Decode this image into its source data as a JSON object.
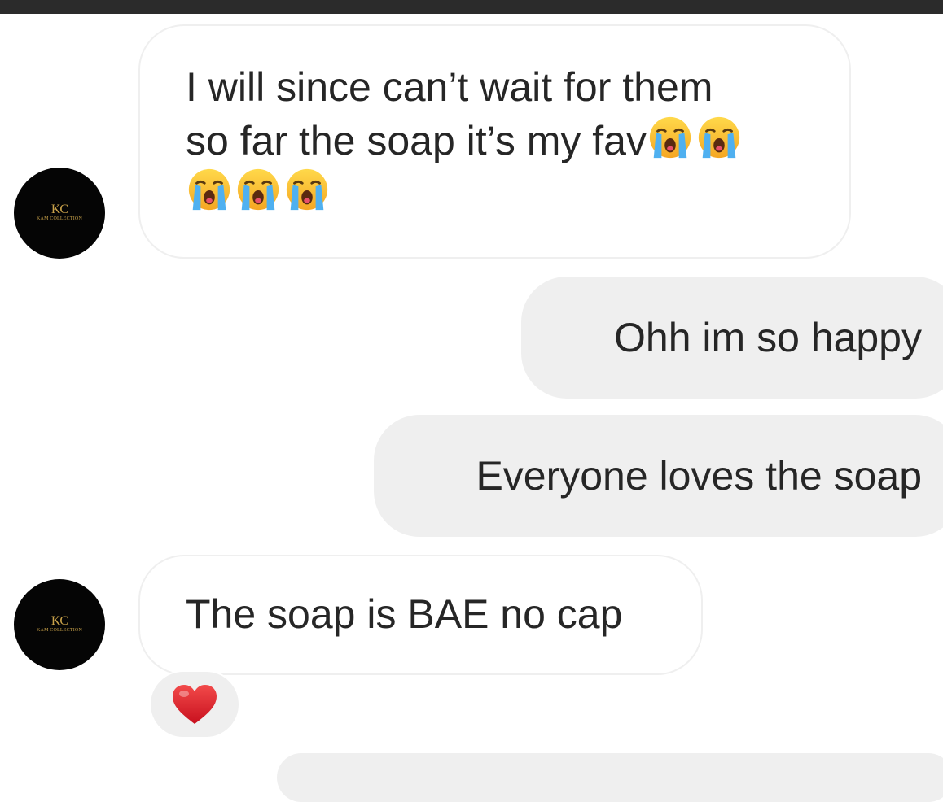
{
  "status_bar": {},
  "avatar": {
    "monogram": "KC",
    "brand": "KAM COLLECTION"
  },
  "messages": [
    {
      "direction": "incoming",
      "lines": [
        "I will since can’t wait for them",
        "so far the soap it’s my fav"
      ],
      "emojis": [
        "loudly-crying-face",
        "loudly-crying-face",
        "loudly-crying-face",
        "loudly-crying-face",
        "loudly-crying-face"
      ]
    },
    {
      "direction": "outgoing",
      "text": "Ohh im so happy"
    },
    {
      "direction": "outgoing",
      "text": "Everyone loves the soap"
    },
    {
      "direction": "incoming",
      "text": "The soap is BAE no cap",
      "reaction": "red-heart"
    }
  ],
  "colors": {
    "incoming_bubble": "#ffffff",
    "incoming_border": "#efefef",
    "outgoing_bubble": "#efefef",
    "text": "#262626",
    "avatar_bg": "#050505",
    "avatar_gold": "#c9a24a",
    "heart": "#e0202e",
    "status_bar": "#2b2b2b"
  }
}
